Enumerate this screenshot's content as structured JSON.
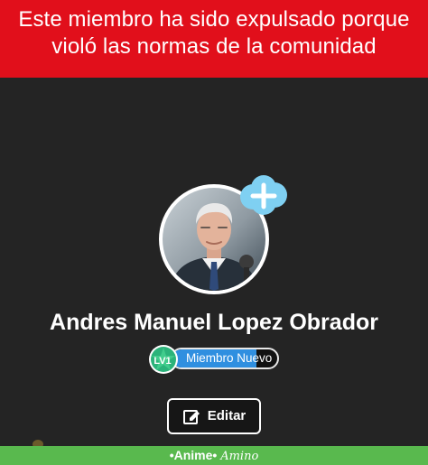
{
  "ban_banner": {
    "line1": "Este miembro ha sido expulsado porque",
    "line2": "violó las normas de la comunidad"
  },
  "profile": {
    "name": "Andres Manuel Lopez Obrador",
    "level_text": "LV1",
    "title_prefix": "Miembro",
    "title_suffix": "Nuevo",
    "title_display": "Miembro Nuevo",
    "level_progress": 0.8
  },
  "actions": {
    "edit_label": "Editar"
  },
  "footer": {
    "brand_part1": "•Anime•",
    "brand_part2": "Amino"
  },
  "colors": {
    "banner": "#e10f1b",
    "background": "#242424",
    "level_badge": "#2bb37a",
    "title_fill": "#2f8fe0",
    "bubble": "#7fd0f2",
    "footer": "#59b94e"
  },
  "icons": {
    "add": "plus-cloud-icon",
    "level": "star-level-icon",
    "edit": "edit-pencil-icon"
  }
}
